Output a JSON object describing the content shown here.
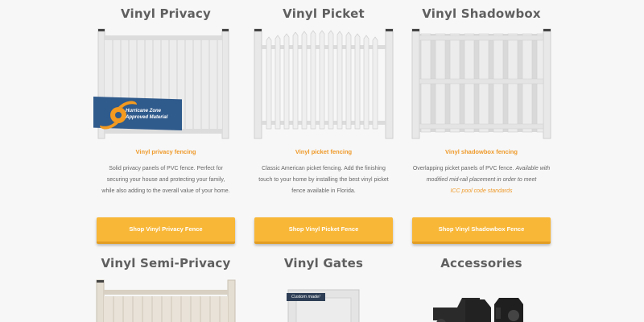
{
  "products": [
    {
      "title": "Vinyl Privacy",
      "caption": "Vinyl privacy fencing",
      "desc": [
        "Solid privacy panels of PVC fence. Perfect for",
        "securing your house and protecting your family,",
        "while also adding to the overall value of your home."
      ],
      "button": "Shop Vinyl Privacy Fence",
      "badge": [
        "Hurricane Zone",
        "Approved Material"
      ]
    },
    {
      "title": "Vinyl Picket",
      "caption": "Vinyl picket fencing",
      "desc": [
        "Classic American picket fencing. Add the finishing",
        "touch to your home by installing the best vinyl picket",
        "fence available in Florida."
      ],
      "button": "Shop Vinyl Picket Fence"
    },
    {
      "title": "Vinyl Shadowbox",
      "caption": "Vinyl shadowbox fencing",
      "desc_plain": "Overlapping picket panels of PVC fence.",
      "desc_italic": "Available with modified mid-rail placement in order to meet",
      "desc_link": "ICC pool code standards",
      "button": "Shop Vinyl Shadowbox Fence"
    }
  ],
  "second_row": {
    "semi_privacy": "Vinyl Semi-Privacy",
    "gates": "Vinyl Gates",
    "gates_tag": "Custom made!",
    "accessories": "Accessories"
  },
  "colors": {
    "accent": "#ef9a2a",
    "button": "#f8b737",
    "badge_blue": "#2f5a8c"
  }
}
